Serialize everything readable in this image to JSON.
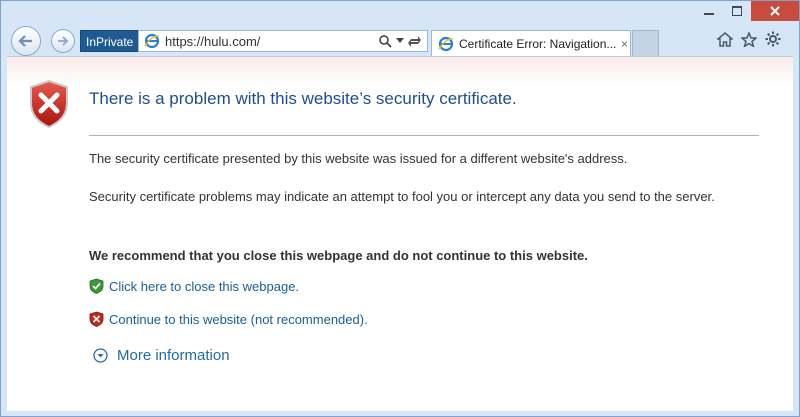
{
  "window": {
    "caption": {
      "minimize_icon": "minimize-icon",
      "maximize_icon": "maximize-icon",
      "close_icon": "close-icon"
    }
  },
  "toolbar": {
    "back_icon": "back-arrow-icon",
    "forward_icon": "forward-arrow-icon",
    "inprivate_label": "InPrivate",
    "address": {
      "url": "https://hulu.com/",
      "search_icon": "search-icon",
      "dropdown_icon": "chevron-down-icon",
      "refresh_icon": "refresh-icon"
    },
    "tab": {
      "label": "Certificate Error: Navigation...",
      "close": "×"
    },
    "right_icons": [
      "home-icon",
      "favorites-star-icon",
      "settings-gear-icon"
    ]
  },
  "page": {
    "heading": "There is a problem with this website’s security certificate.",
    "paragraph1": "The security certificate presented by this website was issued for a different website's address.",
    "paragraph2": "Security certificate problems may indicate an attempt to fool you or intercept any data you send to the server.",
    "recommendation": "We recommend that you close this webpage and do not continue to this website.",
    "close_link": "Click here to close this webpage.",
    "continue_link": "Continue to this website (not recommended).",
    "more_info": "More information"
  },
  "colors": {
    "heading": "#1f4e8c",
    "link": "#1a5e97",
    "inprivate_bg": "#1f5a93",
    "close_button": "#c74b3f",
    "chrome_bg": "#d6e6f7"
  }
}
